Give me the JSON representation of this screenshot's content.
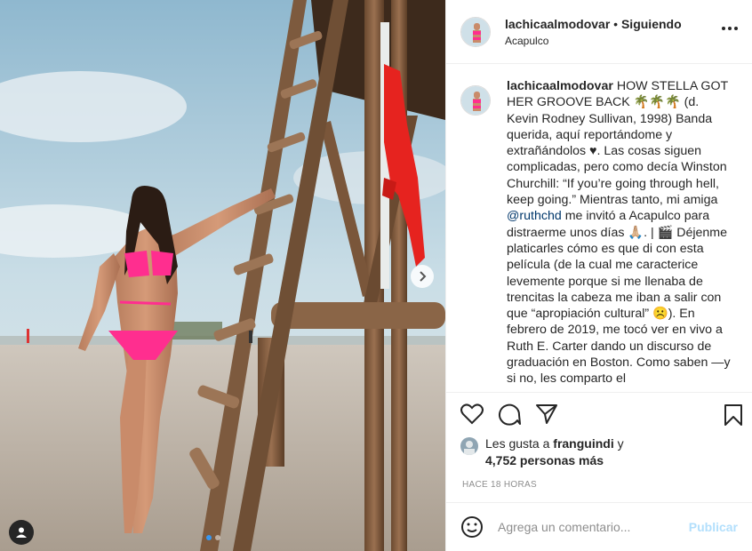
{
  "post": {
    "username": "lachicaalmodovar",
    "follow_status": "Siguiendo",
    "separator": "•",
    "location": "Acapulco",
    "photo_dots": 2
  },
  "caption": {
    "username": "lachicaalmodovar",
    "text_part1": "HOW STELLA GOT HER GROOVE BACK 🌴🌴🌴 (d. Kevin Rodney Sullivan, 1998) Banda querida, aquí reportándome y extrañándolos ♥. Las cosas siguen complicadas, pero como decía Winston Churchill: “If you’re going through hell, keep going.” Mientras tanto, mi amiga",
    "mention": "@ruthchd",
    "text_part2": "me invitó a Acapulco para distraerme unos días 🙏🏼. | 🎬 Déjenme platicarles cómo es que di con esta película (de la cual me caracterice levemente porque si me llenaba de trencitas la cabeza me iban a salir con que “apropiación cultural” ☹️). En febrero de 2019, me tocó ver en vivo a Ruth E. Carter dando un discurso de graduación en Boston. Como saben —y si no, les comparto el"
  },
  "likes": {
    "prefix": "Les gusta a",
    "liker": "franguindi",
    "conj": "y",
    "others": "4,752 personas más"
  },
  "timestamp": "HACE 18 HORAS",
  "comment": {
    "placeholder": "Agrega un comentario...",
    "post_label": "Publicar"
  },
  "colors": {
    "bikini": "#ff2e8f",
    "towel": "#e6231f",
    "link": "#00376b",
    "publish_disabled": "#b2dffc"
  }
}
